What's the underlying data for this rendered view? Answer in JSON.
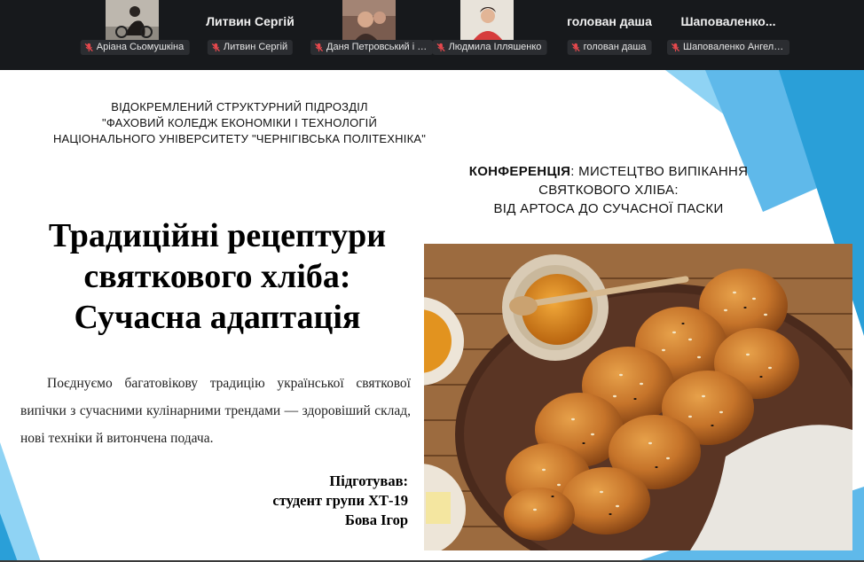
{
  "participants": [
    {
      "display_name": "",
      "tag": "Аріана Сьомушкіна",
      "has_video": true
    },
    {
      "display_name": "Литвин Сергій",
      "tag": "Литвин Сергій",
      "has_video": false
    },
    {
      "display_name": "",
      "tag": "Даня Петровський і П...",
      "has_video": true
    },
    {
      "display_name": "",
      "tag": "Людмила Ілляшенко",
      "has_video": true
    },
    {
      "display_name": "голован даша",
      "tag": "голован даша",
      "has_video": false
    },
    {
      "display_name": "Шаповаленко...",
      "tag": "Шаповаленко Ангеліна",
      "has_video": false
    }
  ],
  "icons": {
    "mic": "muted-microphone-icon"
  },
  "colors": {
    "strip_bg": "#17191c",
    "muted_mic": "#e5484d",
    "slide_accent": "#2a9fd8",
    "slide_accent_light": "#8fd3f4"
  },
  "slide": {
    "organization": [
      "ВІДОКРЕМЛЕНИЙ СТРУКТУРНИЙ ПІДРОЗДІЛ",
      "\"ФАХОВИЙ КОЛЕДЖ ЕКОНОМІКИ І ТЕХНОЛОГІЙ",
      "НАЦІОНАЛЬНОГО УНІВЕРСИТЕТУ \"ЧЕРНІГІВСЬКА ПОЛІТЕХНІКА\""
    ],
    "conference": {
      "label": "КОНФЕРЕНЦІЯ",
      "line1_rest": ": МИСТЕЦТВО ВИПІКАННЯ",
      "line2": "СВЯТКОВОГО ХЛІБА:",
      "line3": "ВІД АРТОСА ДО СУЧАСНОЇ ПАСКИ"
    },
    "title": [
      "Традиційні рецептури",
      "святкового хліба:",
      "Сучасна адаптація"
    ],
    "description": "Поєднуємо багатовікову традицію української святкової випічки з сучасними кулінарними трендами — здоровіший склад, нові техніки й витончена подача.",
    "author": [
      "Підготував:",
      "студент групи ХТ-19",
      "Бова Ігор"
    ]
  }
}
